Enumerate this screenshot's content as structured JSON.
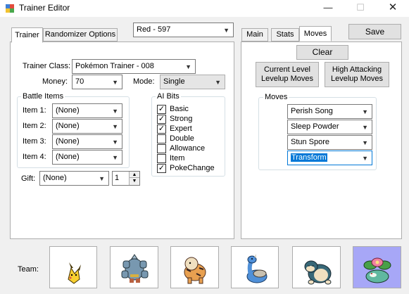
{
  "window": {
    "title": "Trainer Editor",
    "minimize_glyph": "—",
    "maximize_glyph": "☐",
    "close_glyph": "✕"
  },
  "trainer_select": {
    "value": "Red - 597"
  },
  "left_tabs": [
    "Trainer",
    "Randomizer Options"
  ],
  "right_tabs": [
    "Main",
    "Stats",
    "Moves"
  ],
  "save_label": "Save",
  "trainer": {
    "class_label": "Trainer Class:",
    "class_value": "Pokémon Trainer - 008",
    "money_label": "Money:",
    "money_value": "70",
    "mode_label": "Mode:",
    "mode_value": "Single"
  },
  "battle_items": {
    "title": "Battle Items",
    "items": [
      {
        "label": "Item 1:",
        "value": "(None)"
      },
      {
        "label": "Item 2:",
        "value": "(None)"
      },
      {
        "label": "Item 3:",
        "value": "(None)"
      },
      {
        "label": "Item 4:",
        "value": "(None)"
      }
    ]
  },
  "ai_bits": {
    "title": "AI Bits",
    "bits": [
      {
        "label": "Basic",
        "checked": true
      },
      {
        "label": "Strong",
        "checked": true
      },
      {
        "label": "Expert",
        "checked": true
      },
      {
        "label": "Double",
        "checked": false
      },
      {
        "label": "Allowance",
        "checked": false
      },
      {
        "label": "Item",
        "checked": false
      },
      {
        "label": "PokeChange",
        "checked": true
      }
    ]
  },
  "gift": {
    "label": "Gift:",
    "value": "(None)",
    "quantity": "1"
  },
  "moves_panel": {
    "clear_label": "Clear",
    "current_level_label": [
      "Current Level",
      "Levelup Moves"
    ],
    "high_attacking_label": [
      "High Attacking",
      "Levelup Moves"
    ],
    "group_title": "Moves",
    "moves": [
      "Perish Song",
      "Sleep Powder",
      "Stun Spore",
      "Transform"
    ]
  },
  "team": {
    "label": "Team:",
    "members": [
      {
        "icon": "pikachu-sprite-icon",
        "selected": false
      },
      {
        "icon": "machamp-sprite-icon",
        "selected": false
      },
      {
        "icon": "arcanine-sprite-icon",
        "selected": false
      },
      {
        "icon": "lapras-sprite-icon",
        "selected": false
      },
      {
        "icon": "snorlax-sprite-icon",
        "selected": false
      },
      {
        "icon": "venusaur-sprite-icon",
        "selected": true
      }
    ]
  },
  "colors": {
    "selected_team_slot": "#a7a7f7",
    "highlight": "#0078d7"
  }
}
